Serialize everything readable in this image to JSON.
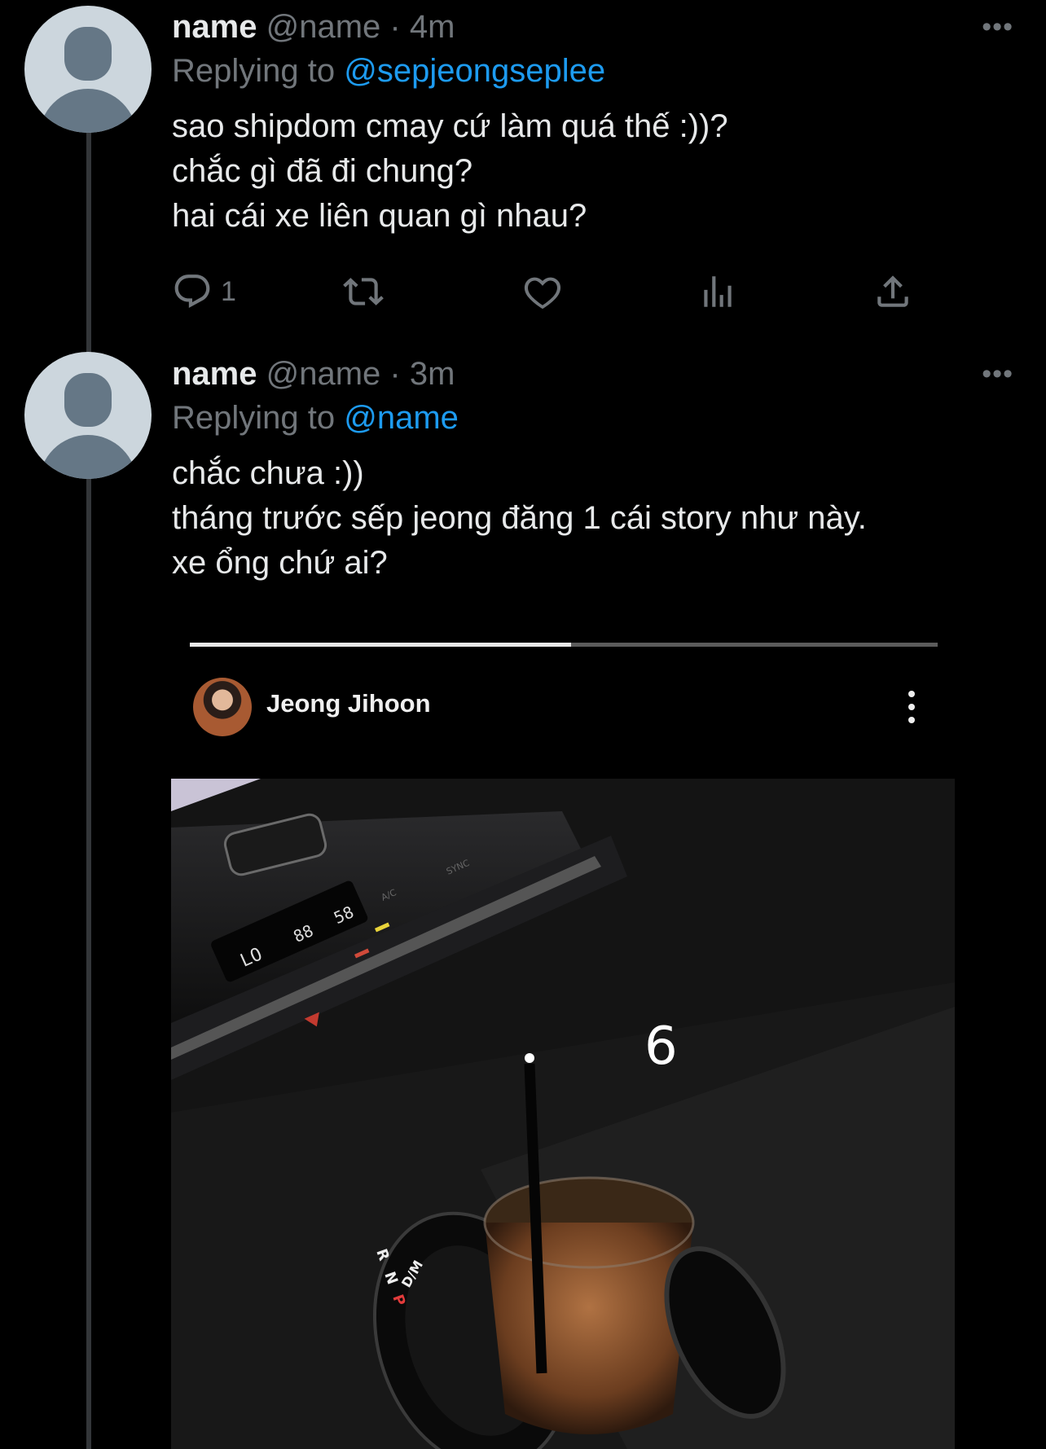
{
  "tweets": [
    {
      "name": "name",
      "handle": "@name",
      "separator": "·",
      "time": "4m",
      "replying_prefix": "Replying to",
      "replying_to": "@sepjeongseplee",
      "text": "sao shipdom cmay cứ làm quá thế :))?\nchắc gì đã đi chung?\nhai cái xe liên quan gì nhau?",
      "more": "•••",
      "reply_count": "1"
    },
    {
      "name": "name",
      "handle": "@name",
      "separator": "·",
      "time": "3m",
      "replying_prefix": "Replying to",
      "replying_to": "@name",
      "text": "chắc chưa :))\ntháng trước sếp jeong đăng 1 cái story như này.\nxe ổng chứ ai?",
      "more": "•••"
    }
  ],
  "story": {
    "username": "Jeong Jihoon",
    "progress": 0.51,
    "overlay_number": "6",
    "screen_labels": {
      "temp_left": "LO",
      "temp_mid": "88",
      "temp_right": "58",
      "gear_r": "R",
      "gear_n": "N",
      "gear_p": "P",
      "gear_d": "D/M",
      "btn_ac": "A/C",
      "btn_sync": "SYNC"
    }
  },
  "colors": {
    "background": "#000000",
    "text": "#e7e9ea",
    "muted": "#71767b",
    "link": "#1d9bf0",
    "thread_line": "#333639"
  },
  "icons": [
    "reply-icon",
    "retweet-icon",
    "like-icon",
    "analytics-icon",
    "share-icon",
    "more-icon"
  ]
}
